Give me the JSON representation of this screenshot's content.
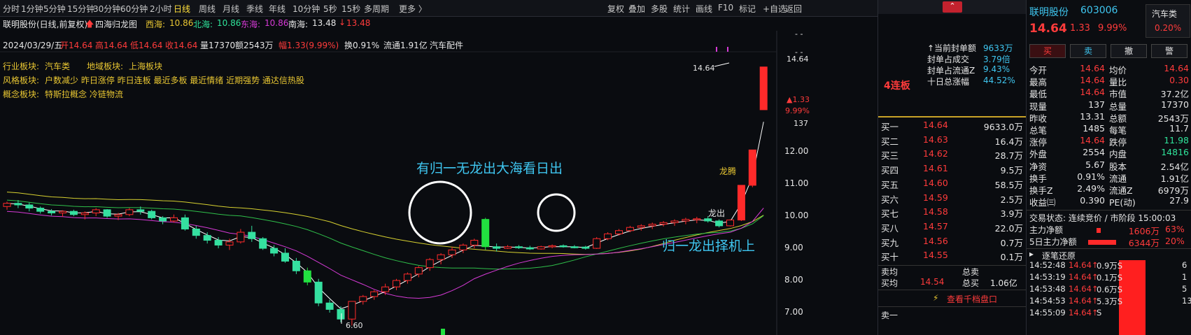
{
  "toolbar": {
    "left": [
      "分时",
      "1分钟",
      "5分钟",
      "15分钟",
      "30分钟",
      "60分钟",
      "2小时",
      "日线",
      "周线",
      "月线",
      "季线",
      "年线",
      "10分钟",
      "5秒",
      "15秒",
      "多周期",
      "更多 〉"
    ],
    "active": "日线",
    "right": [
      "复权",
      "叠加",
      "多股",
      "统计",
      "画线",
      "F10",
      "标记",
      "+自选",
      "返回"
    ]
  },
  "header": {
    "stock": "联明股份(日线,前复权)",
    "indicator": "四海归龙图",
    "xihai_label": "西海:",
    "xihai_val": "10.86",
    "beihai_label": "北海:",
    "beihai_val": "10.86",
    "donghai_label": "东海:",
    "donghai_val": "10.86",
    "nanhai_label": "南海:",
    "nanhai_val": "13.48",
    "nanhai_val2": "13.48"
  },
  "ohlc": {
    "date": "2024/03/29/五",
    "open": "开14.64",
    "high": "高14.64",
    "low": "低14.64",
    "close": "收14.64",
    "vol": "量17370",
    "amt": "额2543万",
    "chg": "幅1.33(9.99%)",
    "turn": "换0.91%",
    "float": "流通1.91亿",
    "sector": "汽车配件"
  },
  "plates": {
    "ind_label": "行业板块:",
    "ind_val": "汽车类",
    "reg_label": "地域板块:",
    "reg_val": "上海板块",
    "style_label": "风格板块:",
    "style_val": "户数减少 昨日涨停 昨日连板 最近多板 最近情绪 近期强势 通达信热股",
    "concept_label": "概念板块:",
    "concept_val": "特斯拉概念 冷链物流"
  },
  "annotations": {
    "a1": "有归一无龙出大海看日出",
    "a2": "归一龙出择机上",
    "a3": "龙腾",
    "a4": "龙出",
    "hi": "14.64",
    "lo": "6.60"
  },
  "chart_data": {
    "type": "candlestick",
    "y_ticks": [
      "12.00",
      "11.00",
      "10.00",
      "9.00",
      "8.00",
      "7.00"
    ],
    "right_labels": [
      "14.64",
      "▲1.33",
      "9.99%",
      "137"
    ],
    "ohlc": [
      [
        10.3,
        10.45,
        10.2,
        10.4
      ],
      [
        10.4,
        10.5,
        10.25,
        10.35
      ],
      [
        10.35,
        10.42,
        10.15,
        10.25
      ],
      [
        10.25,
        10.3,
        10.08,
        10.15
      ],
      [
        10.15,
        10.22,
        10.02,
        10.1
      ],
      [
        10.1,
        10.18,
        9.98,
        10.15
      ],
      [
        10.15,
        10.2,
        10.0,
        10.05
      ],
      [
        10.05,
        10.15,
        9.9,
        10.1
      ],
      [
        10.1,
        10.25,
        10.0,
        10.2
      ],
      [
        10.2,
        10.22,
        9.95,
        10.0
      ],
      [
        10.0,
        10.1,
        9.88,
        10.05
      ],
      [
        10.05,
        10.25,
        10.0,
        10.2
      ],
      [
        10.2,
        10.3,
        10.05,
        10.15
      ],
      [
        10.15,
        10.2,
        9.9,
        9.95
      ],
      [
        9.95,
        10.0,
        9.75,
        9.85
      ],
      [
        9.85,
        10.05,
        9.8,
        9.95
      ],
      [
        9.95,
        10.05,
        9.55,
        9.6
      ],
      [
        9.6,
        9.7,
        9.3,
        9.4
      ],
      [
        9.4,
        9.5,
        9.15,
        9.25
      ],
      [
        9.25,
        9.35,
        9.0,
        9.1
      ],
      [
        9.1,
        9.3,
        8.95,
        9.2
      ],
      [
        9.2,
        9.6,
        9.15,
        9.5
      ],
      [
        9.5,
        9.7,
        9.2,
        9.3
      ],
      [
        9.3,
        9.35,
        8.95,
        9.0
      ],
      [
        9.0,
        9.1,
        8.75,
        8.85
      ],
      [
        8.85,
        9.0,
        8.55,
        8.6
      ],
      [
        8.6,
        8.7,
        8.2,
        8.3
      ],
      [
        8.3,
        8.4,
        7.85,
        7.95
      ],
      [
        7.95,
        8.05,
        7.2,
        7.3
      ],
      [
        7.3,
        7.4,
        7.0,
        7.1
      ],
      [
        7.1,
        7.2,
        6.7,
        6.8
      ],
      [
        6.8,
        7.35,
        6.6,
        7.35
      ],
      [
        7.35,
        7.55,
        7.25,
        7.5
      ],
      [
        7.5,
        7.7,
        7.4,
        7.65
      ],
      [
        7.65,
        7.9,
        7.55,
        7.8
      ],
      [
        7.8,
        8.05,
        7.7,
        8.0
      ],
      [
        8.0,
        8.25,
        7.9,
        8.2
      ],
      [
        8.2,
        8.45,
        8.1,
        8.4
      ],
      [
        8.4,
        8.7,
        8.3,
        8.65
      ],
      [
        8.65,
        8.85,
        8.5,
        8.8
      ],
      [
        8.8,
        9.05,
        8.7,
        8.95
      ],
      [
        8.95,
        9.15,
        8.85,
        9.1
      ],
      [
        9.1,
        9.3,
        9.0,
        9.25
      ],
      [
        9.9,
        9.95,
        8.95,
        9.05
      ],
      [
        9.05,
        9.15,
        8.9,
        9.0
      ],
      [
        9.0,
        9.1,
        8.98,
        9.05
      ],
      [
        9.05,
        9.1,
        8.98,
        9.02
      ],
      [
        9.02,
        9.08,
        8.95,
        8.98
      ],
      [
        8.98,
        9.08,
        8.96,
        9.05
      ],
      [
        9.05,
        9.12,
        9.0,
        9.08
      ],
      [
        9.08,
        9.12,
        9.02,
        9.05
      ],
      [
        9.05,
        9.1,
        9.0,
        9.04
      ],
      [
        9.04,
        9.08,
        8.96,
        9.0
      ],
      [
        9.0,
        9.35,
        8.98,
        9.3
      ],
      [
        9.3,
        9.5,
        9.25,
        9.45
      ],
      [
        9.45,
        9.6,
        9.4,
        9.55
      ],
      [
        9.55,
        9.7,
        9.5,
        9.65
      ],
      [
        9.65,
        9.75,
        9.55,
        9.7
      ],
      [
        9.7,
        9.8,
        9.6,
        9.75
      ],
      [
        9.75,
        9.85,
        9.68,
        9.8
      ],
      [
        9.8,
        9.9,
        9.7,
        9.85
      ],
      [
        9.85,
        9.95,
        9.75,
        9.9
      ],
      [
        9.9,
        9.98,
        9.78,
        9.92
      ],
      [
        9.92,
        10.0,
        9.8,
        9.85
      ],
      [
        9.85,
        9.9,
        9.65,
        9.7
      ],
      [
        9.7,
        9.9,
        9.68,
        9.88
      ],
      [
        9.88,
        10.96,
        9.85,
        10.96
      ],
      [
        10.96,
        12.06,
        10.9,
        12.06
      ],
      [
        13.31,
        14.64,
        13.31,
        14.64
      ]
    ]
  },
  "l2": {
    "lianban": "4连板",
    "items": [
      [
        "↑当前封单额",
        "9633万"
      ],
      [
        "封单占成交",
        "3.79倍"
      ],
      [
        "封单占流通Z",
        "9.43%"
      ],
      [
        "十日总涨幅",
        "44.52%"
      ]
    ]
  },
  "bids": [
    [
      "买一",
      "14.64",
      "9633.0万"
    ],
    [
      "买二",
      "14.63",
      "16.4万"
    ],
    [
      "买三",
      "14.62",
      "28.7万"
    ],
    [
      "买四",
      "14.61",
      "9.5万"
    ],
    [
      "买五",
      "14.60",
      "58.5万"
    ],
    [
      "买六",
      "14.59",
      "2.5万"
    ],
    [
      "买七",
      "14.58",
      "3.9万"
    ],
    [
      "买八",
      "14.57",
      "22.0万"
    ],
    [
      "买九",
      "14.56",
      "0.7万"
    ],
    [
      "买十",
      "14.55",
      "0.1万"
    ]
  ],
  "sellavg": {
    "l1": "卖均",
    "l2": "总卖",
    "bl": "买均",
    "bv": "14.54",
    "tl": "总买",
    "tv": "1.06亿"
  },
  "qianfang": "查看千档盘口",
  "sell1": "卖一",
  "quote": {
    "name": "联明股份",
    "code": "603006",
    "price": "14.64",
    "chg": "1.33",
    "pct": "9.99%",
    "sector": "汽车类",
    "sector_pct": "0.20%",
    "buttons": [
      "买",
      "卖",
      "撤",
      "警"
    ],
    "rows": [
      [
        "今开",
        "14.64",
        "均价",
        "14.64"
      ],
      [
        "最高",
        "14.64",
        "量比",
        "0.30"
      ],
      [
        "最低",
        "14.64",
        "市值",
        "37.2亿"
      ],
      [
        "现量",
        "137",
        "总量",
        "17370"
      ],
      [
        "昨收",
        "13.31",
        "总额",
        "2543万"
      ],
      [
        "总笔",
        "1485",
        "每笔",
        "11.7"
      ],
      [
        "涨停",
        "14.64",
        "跌停",
        "11.98"
      ],
      [
        "外盘",
        "2554",
        "内盘",
        "14816"
      ],
      [
        "净资",
        "5.67",
        "股本",
        "2.54亿"
      ],
      [
        "换手",
        "0.91%",
        "流通",
        "1.91亿"
      ],
      [
        "换手Z",
        "2.49%",
        "流通Z",
        "6979万"
      ],
      [
        "收益㈢",
        "0.390",
        "PE(动)",
        "27.9"
      ]
    ],
    "status": "交易状态: 连续竞价 / 市阶段 15:00:03",
    "flow": [
      [
        "主力净额",
        "1606万",
        "63%"
      ],
      [
        "5日主力净额",
        "6344万",
        "20%"
      ]
    ],
    "ticks_title": "逐笔还原",
    "ticks": [
      [
        "14:52:48",
        "14.64",
        "0.9万",
        "S",
        "6"
      ],
      [
        "14:53:19",
        "14.64",
        "0.1万",
        "S",
        "1"
      ],
      [
        "14:53:48",
        "14.64",
        "0.6万",
        "S",
        "5"
      ],
      [
        "14:54:53",
        "14.64",
        "5.3万",
        "S",
        "13"
      ],
      [
        "14:55:09",
        "14.64",
        "",
        "S",
        ""
      ]
    ]
  }
}
